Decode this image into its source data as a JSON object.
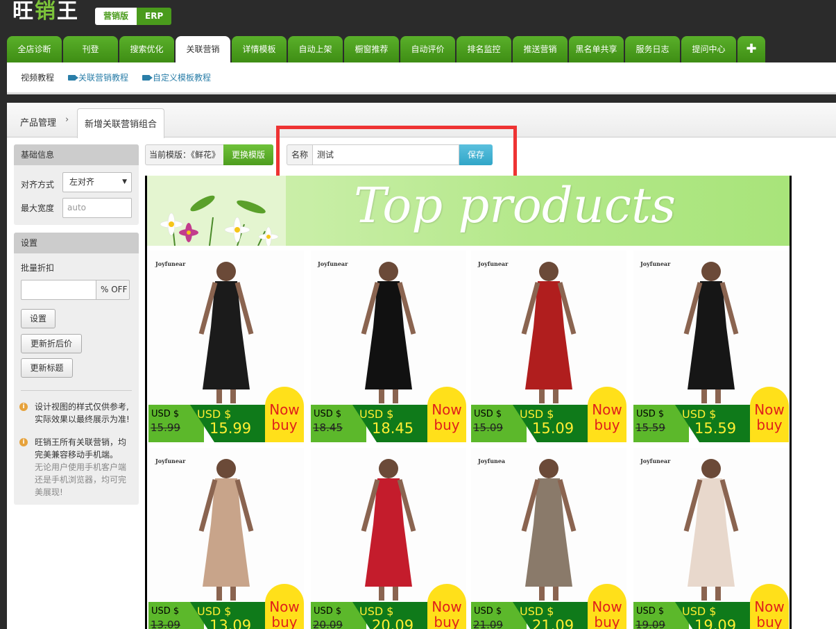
{
  "logo": {
    "text_a": "旺",
    "text_b": "销",
    "text_c": "王"
  },
  "edition": {
    "active": "营销版",
    "other": "ERP"
  },
  "tabs": [
    "全店诊断",
    "刊登",
    "搜索优化",
    "关联营销",
    "详情模板",
    "自动上架",
    "橱窗推荐",
    "自动评价",
    "排名监控",
    "推送营销",
    "黑名单共享",
    "服务日志",
    "提问中心",
    "✚"
  ],
  "active_tab": "关联营销",
  "subbar": {
    "label": "视频教程",
    "link1": "关联营销教程",
    "link2": "自定义模板教程"
  },
  "breadcrumb": {
    "parent": "产品管理",
    "sep": "›",
    "current": "新增关联营销组合"
  },
  "basic": {
    "title": "基础信息",
    "align_label": "对齐方式",
    "align_value": "左对齐",
    "width_label": "最大宽度",
    "width_placeholder": "auto"
  },
  "settings": {
    "title": "设置",
    "discount_label": "批量折扣",
    "discount_suffix": "% OFF",
    "set_btn": "设置",
    "update_price_btn": "更新折后价",
    "update_title_btn": "更新标题",
    "notice1": "设计视图的样式仅供参考,实际效果以最终展示为准!",
    "notice2_main": "旺销王所有关联营销，均完美兼容移动手机端。",
    "notice2_sub": "无论用户使用手机客户端还是手机浏览器，均可完美展现!"
  },
  "template": {
    "label": "当前模版：《鲜花》",
    "change_btn": "更换模版"
  },
  "name_field": {
    "label": "名称",
    "value": "测试",
    "save_btn": "保存"
  },
  "banner_title": "Top products",
  "products": [
    {
      "brand": "Joyfunear",
      "old_usd": "USD $",
      "old": "15.99",
      "new_usd": "USD $",
      "new": "15.99",
      "cta1": "Now",
      "cta2": "buy",
      "color": "#1b1b1b"
    },
    {
      "brand": "Joyfunear",
      "old_usd": "USD $",
      "old": "18.45",
      "new_usd": "USD $",
      "new": "18.45",
      "cta1": "Now",
      "cta2": "buy",
      "color": "#111111"
    },
    {
      "brand": "Joyfunear",
      "old_usd": "USD $",
      "old": "15.09",
      "new_usd": "USD $",
      "new": "15.09",
      "cta1": "Now",
      "cta2": "buy",
      "color": "#b01e1e"
    },
    {
      "brand": "Joyfunear",
      "old_usd": "USD $",
      "old": "15.59",
      "new_usd": "USD $",
      "new": "15.59",
      "cta1": "Now",
      "cta2": "buy",
      "color": "#161616"
    },
    {
      "brand": "Joyfunear",
      "old_usd": "USD $",
      "old": "13.09",
      "new_usd": "USD $",
      "new": "13.09",
      "cta1": "Now",
      "cta2": "buy",
      "color": "#c8a48a"
    },
    {
      "brand": "",
      "old_usd": "USD $",
      "old": "20.09",
      "new_usd": "USD $",
      "new": "20.09",
      "cta1": "Now",
      "cta2": "buy",
      "color": "#c41c2c"
    },
    {
      "brand": "Joyfunea",
      "old_usd": "USD $",
      "old": "21.09",
      "new_usd": "USD $",
      "new": "21.09",
      "cta1": "Now",
      "cta2": "buy",
      "color": "#8a7a6a"
    },
    {
      "brand": "Joyfunear",
      "old_usd": "USD $",
      "old": "19.09",
      "new_usd": "USD $",
      "new": "19.09",
      "cta1": "Now",
      "cta2": "buy",
      "color": "#e8d8cc"
    }
  ]
}
